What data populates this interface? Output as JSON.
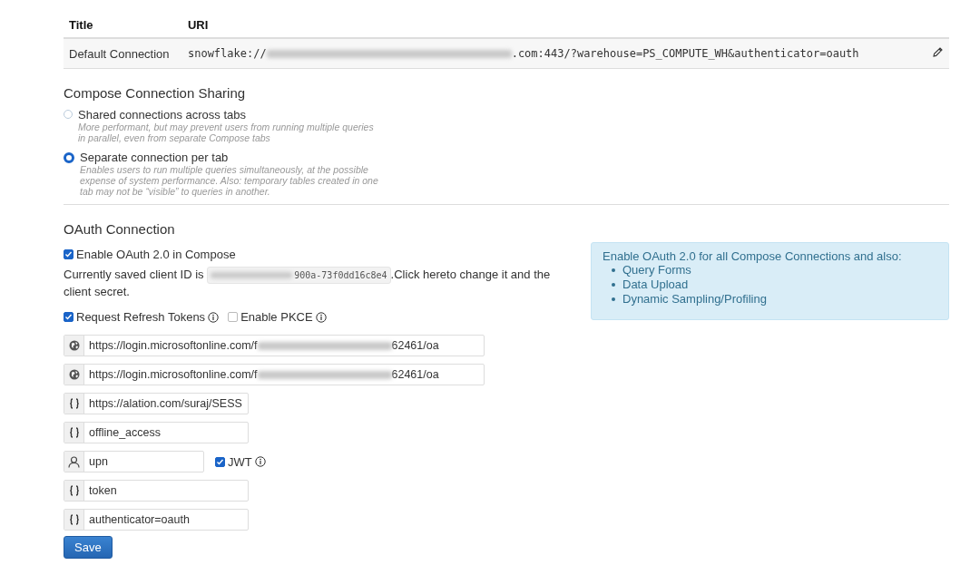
{
  "table": {
    "columns": [
      "Title",
      "URI"
    ],
    "rows": [
      {
        "title": "Default Connection",
        "uri_prefix": "snowflake://",
        "uri_suffix": ".com:443/?warehouse=PS_COMPUTE_WH&authenticator=oauth"
      }
    ]
  },
  "sharing": {
    "heading": "Compose Connection Sharing",
    "options": [
      {
        "label": "Shared connections across tabs",
        "description": "More performant, but may prevent users from running multiple queries in parallel, even from separate Compose tabs",
        "selected": false
      },
      {
        "label": "Separate connection per tab",
        "description": "Enables users to run multiple queries simultaneously, at the possible expense of system performance. Also: temporary tables created in one tab may not be “visible” to queries in another.",
        "selected": true
      }
    ]
  },
  "oauth": {
    "heading": "OAuth Connection",
    "enable": {
      "label": "Enable OAuth 2.0 in Compose",
      "checked": true
    },
    "client_id": {
      "text_before": "Currently saved client ID is",
      "id_suffix": "900a-73f0dd16c8e4",
      "separator": ".",
      "link": "Click here",
      "text_after": "to change it and the client secret."
    },
    "options": [
      {
        "label": "Request Refresh Tokens",
        "checked": true
      },
      {
        "label": "Enable PKCE",
        "checked": false
      }
    ],
    "fields": [
      {
        "kind": "endpoint",
        "value": "https://login.microsoftonline.com/f",
        "value_end": "62461/oa"
      },
      {
        "kind": "endpoint",
        "value": "https://login.microsoftonline.com/f",
        "value_end": "62461/oa"
      },
      {
        "kind": "value",
        "value": "https://alation.com/suraj/SESS"
      },
      {
        "kind": "value",
        "value": "offline_access"
      },
      {
        "kind": "user",
        "value": "upn",
        "jwt": {
          "label": "JWT",
          "checked": true
        }
      },
      {
        "kind": "value",
        "value": "token"
      },
      {
        "kind": "value",
        "value": "authenticator=oauth"
      }
    ],
    "save_button": "Save"
  },
  "info": {
    "title": "Enable OAuth 2.0 for all Compose Connections and also:",
    "items": [
      "Query Forms",
      "Data Upload",
      "Dynamic Sampling/Profiling"
    ]
  }
}
